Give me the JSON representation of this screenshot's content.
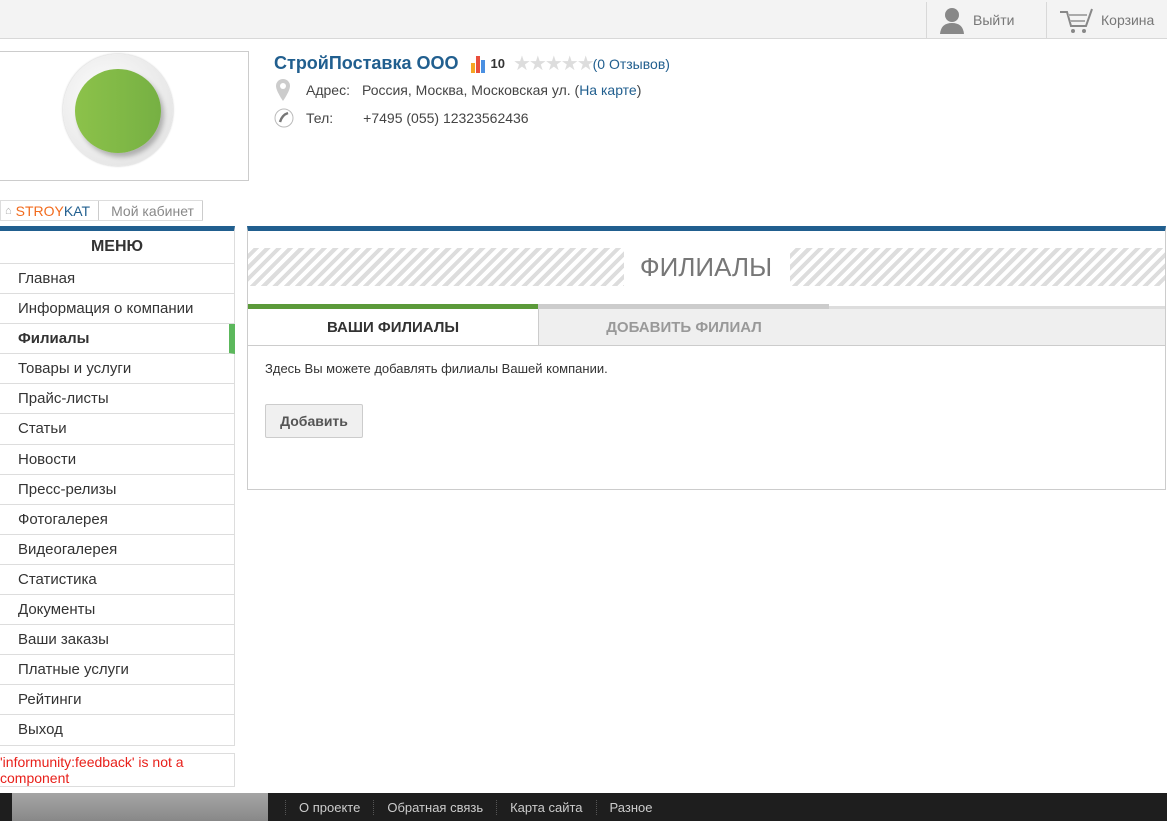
{
  "topbar": {
    "logout": "Выйти",
    "cart": "Корзина"
  },
  "company": {
    "name": "СтройПоставка ООО",
    "rating": "10",
    "reviews": "(0 Отзывов)",
    "address_label": "Адрес:",
    "address": "Россия, Москва, Московская ул. (",
    "map_link": "На карте",
    "address_close": ")",
    "phone_label": "Тел:",
    "phone": "+7495 (055) 12323562436"
  },
  "breadcrumb": {
    "home_a": "STROY",
    "home_b": "KAT",
    "current": "Мой кабинет"
  },
  "menu": {
    "title": "МЕНЮ",
    "items": [
      "Главная",
      "Информация о компании",
      "Филиалы",
      "Товары и услуги",
      "Прайс-листы",
      "Статьи",
      "Новости",
      "Пресс-релизы",
      "Фотогалерея",
      "Видеогалерея",
      "Статистика",
      "Документы",
      "Ваши заказы",
      "Платные услуги",
      "Рейтинги",
      "Выход"
    ]
  },
  "error": "'informunity:feedback' is not a component",
  "main": {
    "title": "ФИЛИАЛЫ",
    "tabs": [
      "ВАШИ ФИЛИАЛЫ",
      "ДОБАВИТЬ ФИЛИАЛ"
    ],
    "text": "Здесь Вы можете добавлять филиалы Вашей компании.",
    "add_button": "Добавить"
  },
  "footer": {
    "links": [
      "О проекте",
      "Обратная связь",
      "Карта сайта",
      "Разное"
    ]
  }
}
